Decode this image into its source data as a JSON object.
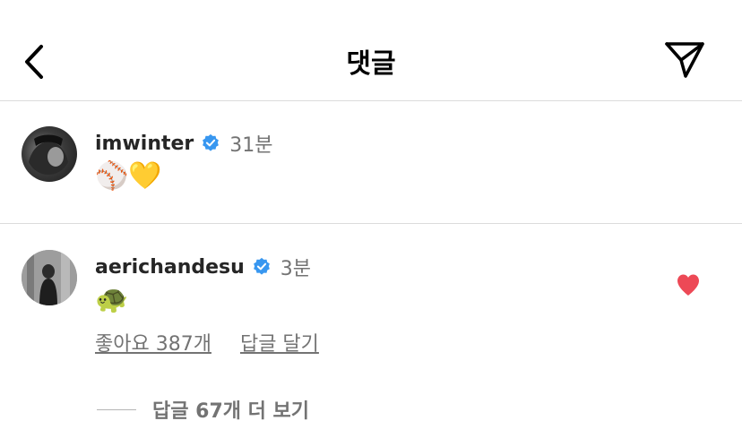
{
  "header": {
    "title": "댓글",
    "back_icon": "chevron-left-icon",
    "send_icon": "paper-plane-icon"
  },
  "comments": [
    {
      "username": "imwinter",
      "verified": true,
      "time": "31분",
      "text": "⚾💛"
    },
    {
      "username": "aerichandesu",
      "verified": true,
      "time": "3분",
      "text": "🐢",
      "liked": true,
      "likes_label": "좋아요 387개",
      "reply_label": "답글 달기",
      "view_replies_label": "답글 67개 더 보기"
    }
  ],
  "colors": {
    "verified_blue": "#3897f0",
    "heart_red": "#ed4956",
    "muted_text": "#737373",
    "divider": "#dbdbdb"
  }
}
